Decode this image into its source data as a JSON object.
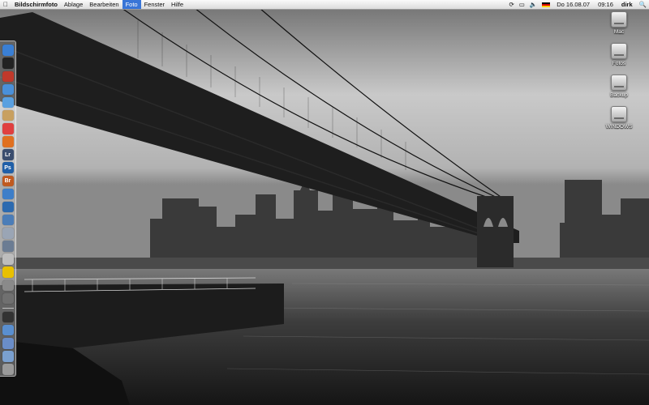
{
  "menubar": {
    "apple_icon": "apple-icon",
    "app_name": "Bildschirmfoto",
    "menus": [
      "Ablage",
      "Bearbeiten",
      "Foto",
      "Fenster",
      "Hilfe"
    ],
    "active_menu": "Foto",
    "status_icons": [
      "sync-icon",
      "display-icon",
      "volume-icon",
      "flag-de-icon"
    ],
    "date": "Do 16.08.07",
    "time": "09:16",
    "user": "dirk",
    "spotlight_icon": "spotlight-search-icon"
  },
  "desktop_icons": [
    {
      "label": "Mac",
      "icon": "hard-drive-icon"
    },
    {
      "label": "Fotos",
      "icon": "hard-drive-icon"
    },
    {
      "label": "Backup",
      "icon": "hard-drive-icon"
    },
    {
      "label": "WINDOWS",
      "icon": "hard-drive-icon"
    }
  ],
  "dock": {
    "items": [
      {
        "icon": "finder-icon",
        "glyph": "",
        "color": "#3a7fd4"
      },
      {
        "icon": "dashboard-icon",
        "glyph": "",
        "color": "#222222"
      },
      {
        "icon": "itunes-icon",
        "glyph": "",
        "color": "#c0392b"
      },
      {
        "icon": "mail-icon",
        "glyph": "",
        "color": "#4a90d9"
      },
      {
        "icon": "safari-icon",
        "glyph": "",
        "color": "#5aa0e0"
      },
      {
        "icon": "address-book-icon",
        "glyph": "",
        "color": "#c8a060"
      },
      {
        "icon": "ical-icon",
        "glyph": "",
        "color": "#e04040"
      },
      {
        "icon": "firefox-icon",
        "glyph": "",
        "color": "#e07020"
      },
      {
        "icon": "lightroom-icon",
        "glyph": "Lr",
        "color": "#3a4d6e"
      },
      {
        "icon": "photoshop-icon",
        "glyph": "Ps",
        "color": "#1f5fa8"
      },
      {
        "icon": "bridge-icon",
        "glyph": "Br",
        "color": "#c05a20"
      },
      {
        "icon": "network-icon",
        "glyph": "",
        "color": "#3d7ec9"
      },
      {
        "icon": "globe-icon",
        "glyph": "",
        "color": "#2c6ab0"
      },
      {
        "icon": "chat-icon",
        "glyph": "",
        "color": "#4b7db8"
      },
      {
        "icon": "preview-icon",
        "glyph": "",
        "color": "#9aa5b5"
      },
      {
        "icon": "utilities-icon",
        "glyph": "",
        "color": "#6b7c93"
      },
      {
        "icon": "text-edit-icon",
        "glyph": "",
        "color": "#bdbdbd"
      },
      {
        "icon": "ftp-icon",
        "glyph": "",
        "color": "#e8c000"
      },
      {
        "icon": "system-preferences-icon",
        "glyph": "",
        "color": "#8a8a8a"
      },
      {
        "icon": "calculator-icon",
        "glyph": "",
        "color": "#707070"
      },
      {
        "icon": "terminal-icon",
        "glyph": "",
        "color": "#333333"
      },
      {
        "icon": "documents-icon",
        "glyph": "",
        "color": "#5a8fd0"
      },
      {
        "icon": "applications-icon",
        "glyph": "",
        "color": "#6a8dc8"
      },
      {
        "icon": "downloads-icon",
        "glyph": "",
        "color": "#7aa0d0"
      },
      {
        "icon": "trash-icon",
        "glyph": "",
        "color": "#9a9a9a"
      }
    ],
    "separator_after": 20
  },
  "wallpaper": {
    "description_icon": "wallpaper-image",
    "colors": {
      "sky": "#bdbdbd",
      "water": "#3a3a3a",
      "bridge": "#1a1a1a"
    }
  }
}
